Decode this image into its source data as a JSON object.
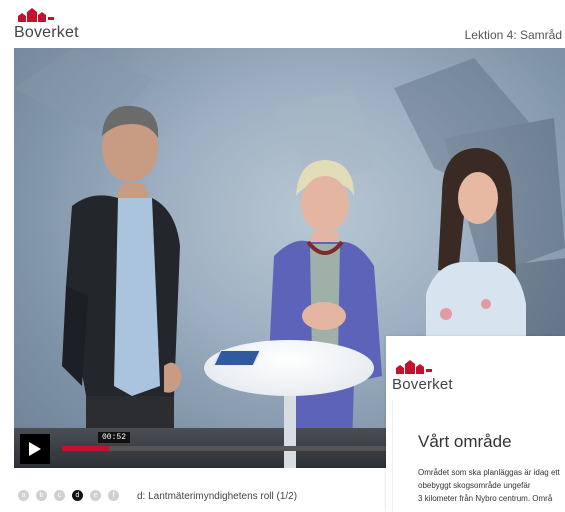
{
  "header": {
    "brand": "Boverket",
    "lesson_title": "Lektion 4: Samråd"
  },
  "player": {
    "play_icon": "play-icon",
    "current_time": "00:52",
    "progress_fraction": 0.095
  },
  "chapters": {
    "items": [
      {
        "label": "a",
        "active": false
      },
      {
        "label": "b",
        "active": false
      },
      {
        "label": "c",
        "active": false
      },
      {
        "label": "d",
        "active": true
      },
      {
        "label": "e",
        "active": false
      },
      {
        "label": "f",
        "active": false
      }
    ],
    "current_title": "d: Lantmäterimyndighetens roll (1/2)"
  },
  "slide": {
    "brand": "Boverket",
    "heading": "Vårt område",
    "lines": [
      "Området som ska planläggas är idag ett",
      "obebyggt skogsområde ungefär",
      "3 kilometer från Nybro centrum. Områ"
    ]
  },
  "colors": {
    "brand_red": "#c8102e",
    "progress_played": "#c8102e"
  }
}
